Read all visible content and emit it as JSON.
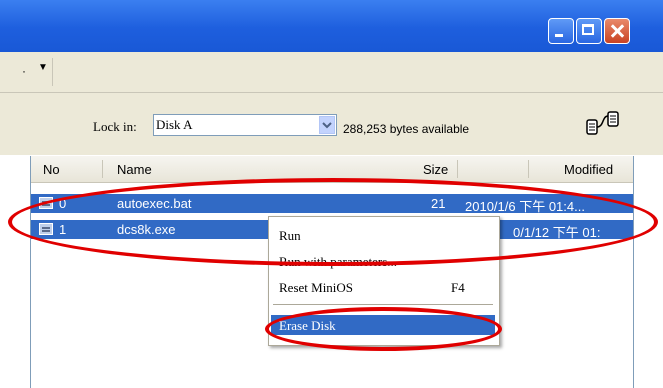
{
  "window": {
    "controls": [
      {
        "name": "minimize-icon"
      },
      {
        "name": "maximize-icon"
      },
      {
        "name": "close-icon"
      }
    ]
  },
  "menubar": {
    "dots": "·",
    "arrow": "▼"
  },
  "toolbar": {
    "lock_label": "Lock in:",
    "lock_value": "Disk A",
    "dropdown_arrow": "⌄",
    "available": "288,253 bytes available",
    "icon": "network-connection-icon"
  },
  "list": {
    "columns": [
      "No",
      "Name",
      "Size",
      "Modified"
    ],
    "rows": [
      {
        "no": "0",
        "name": "autoexec.bat",
        "size": "21",
        "modified": "2010/1/6 下午 01:4..."
      },
      {
        "no": "1",
        "name": "dcs8k.exe",
        "size": "",
        "modified": "0/1/12 下午 01:"
      }
    ]
  },
  "context_menu": {
    "items": [
      {
        "label": "Run",
        "key": ""
      },
      {
        "label": "Run with parameters...",
        "key": ""
      },
      {
        "label": "Reset MiniOS",
        "key": "F4"
      },
      {
        "label": "Erase Disk",
        "key": "",
        "selected": true
      }
    ]
  },
  "colors": {
    "title_blue": "#1553d0",
    "selection": "#316ac5",
    "highlight_circle": "#e00000"
  }
}
